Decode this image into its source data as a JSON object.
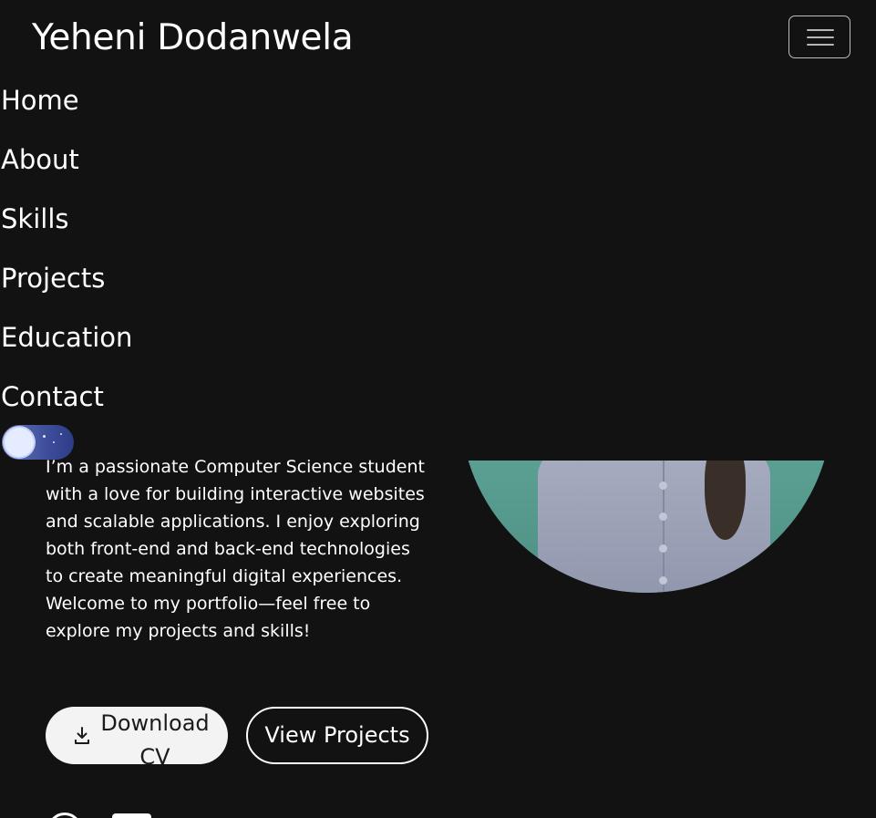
{
  "header": {
    "brand": "Yeheni Dodanwela",
    "menu_toggle_icon": "hamburger-icon"
  },
  "nav": {
    "items": [
      {
        "label": "Home"
      },
      {
        "label": "About"
      },
      {
        "label": "Skills"
      },
      {
        "label": "Projects"
      },
      {
        "label": "Education"
      },
      {
        "label": "Contact"
      }
    ]
  },
  "theme_toggle": {
    "icon": "moon-stars-icon",
    "mode": "dark"
  },
  "hero": {
    "bio": "I’m a passionate Computer Science student with a love for building interactive websites and scalable applications. I enjoy exploring both front-end and back-end technologies to create meaningful digital experiences. Welcome to my portfolio—feel free to explore my projects and skills!",
    "download_label": "Download CV",
    "download_icon": "download-icon",
    "projects_label": "View Projects"
  },
  "social": [
    {
      "icon": "github-icon"
    },
    {
      "icon": "linkedin-icon"
    }
  ],
  "colors": {
    "background": "#121212",
    "text": "#ffffff",
    "toggle_track": "#3f4f9c",
    "primary_button_bg": "#f3f3f3"
  }
}
